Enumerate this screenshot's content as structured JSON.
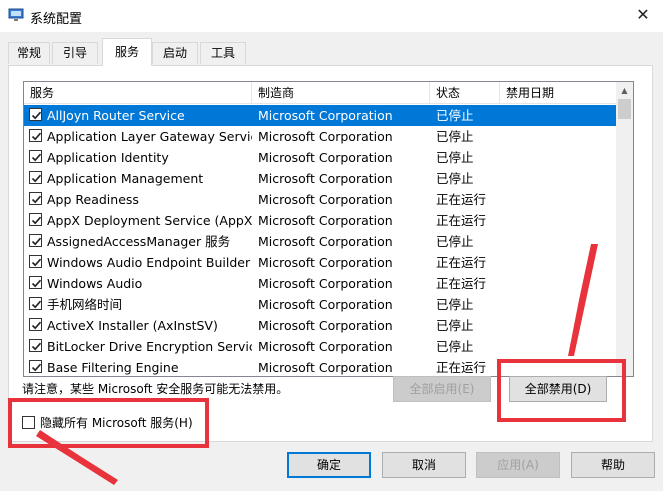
{
  "window": {
    "title": "系统配置",
    "close_glyph": "✕"
  },
  "tabs": [
    "常规",
    "引导",
    "服务",
    "启动",
    "工具"
  ],
  "table": {
    "headers": [
      "服务",
      "制造商",
      "状态",
      "禁用日期"
    ],
    "rows": [
      {
        "service": "AllJoyn Router Service",
        "maker": "Microsoft Corporation",
        "status": "已停止",
        "disabled_date": ""
      },
      {
        "service": "Application Layer Gateway Service",
        "maker": "Microsoft Corporation",
        "status": "已停止",
        "disabled_date": ""
      },
      {
        "service": "Application Identity",
        "maker": "Microsoft Corporation",
        "status": "已停止",
        "disabled_date": ""
      },
      {
        "service": "Application Management",
        "maker": "Microsoft Corporation",
        "status": "已停止",
        "disabled_date": ""
      },
      {
        "service": "App Readiness",
        "maker": "Microsoft Corporation",
        "status": "正在运行",
        "disabled_date": ""
      },
      {
        "service": "AppX Deployment Service (AppX...",
        "maker": "Microsoft Corporation",
        "status": "正在运行",
        "disabled_date": ""
      },
      {
        "service": "AssignedAccessManager 服务",
        "maker": "Microsoft Corporation",
        "status": "已停止",
        "disabled_date": ""
      },
      {
        "service": "Windows Audio Endpoint Builder",
        "maker": "Microsoft Corporation",
        "status": "正在运行",
        "disabled_date": ""
      },
      {
        "service": "Windows Audio",
        "maker": "Microsoft Corporation",
        "status": "正在运行",
        "disabled_date": ""
      },
      {
        "service": "手机网络时间",
        "maker": "Microsoft Corporation",
        "status": "已停止",
        "disabled_date": ""
      },
      {
        "service": "ActiveX Installer (AxInstSV)",
        "maker": "Microsoft Corporation",
        "status": "已停止",
        "disabled_date": ""
      },
      {
        "service": "BitLocker Drive Encryption Service",
        "maker": "Microsoft Corporation",
        "status": "已停止",
        "disabled_date": ""
      },
      {
        "service": "Base Filtering Engine",
        "maker": "Microsoft Corporation",
        "status": "正在运行",
        "disabled_date": ""
      }
    ],
    "selected_index": 0
  },
  "note": "请注意，某些 Microsoft 安全服务可能无法禁用。",
  "buttons": {
    "enable_all": "全部启用(E)",
    "disable_all": "全部禁用(D)",
    "ok": "确定",
    "cancel": "取消",
    "apply": "应用(A)",
    "help": "帮助"
  },
  "hide_ms_label": "隐藏所有 Microsoft 服务(H)",
  "colors": {
    "selection": "#0078d7",
    "highlight": "#e8323c"
  }
}
